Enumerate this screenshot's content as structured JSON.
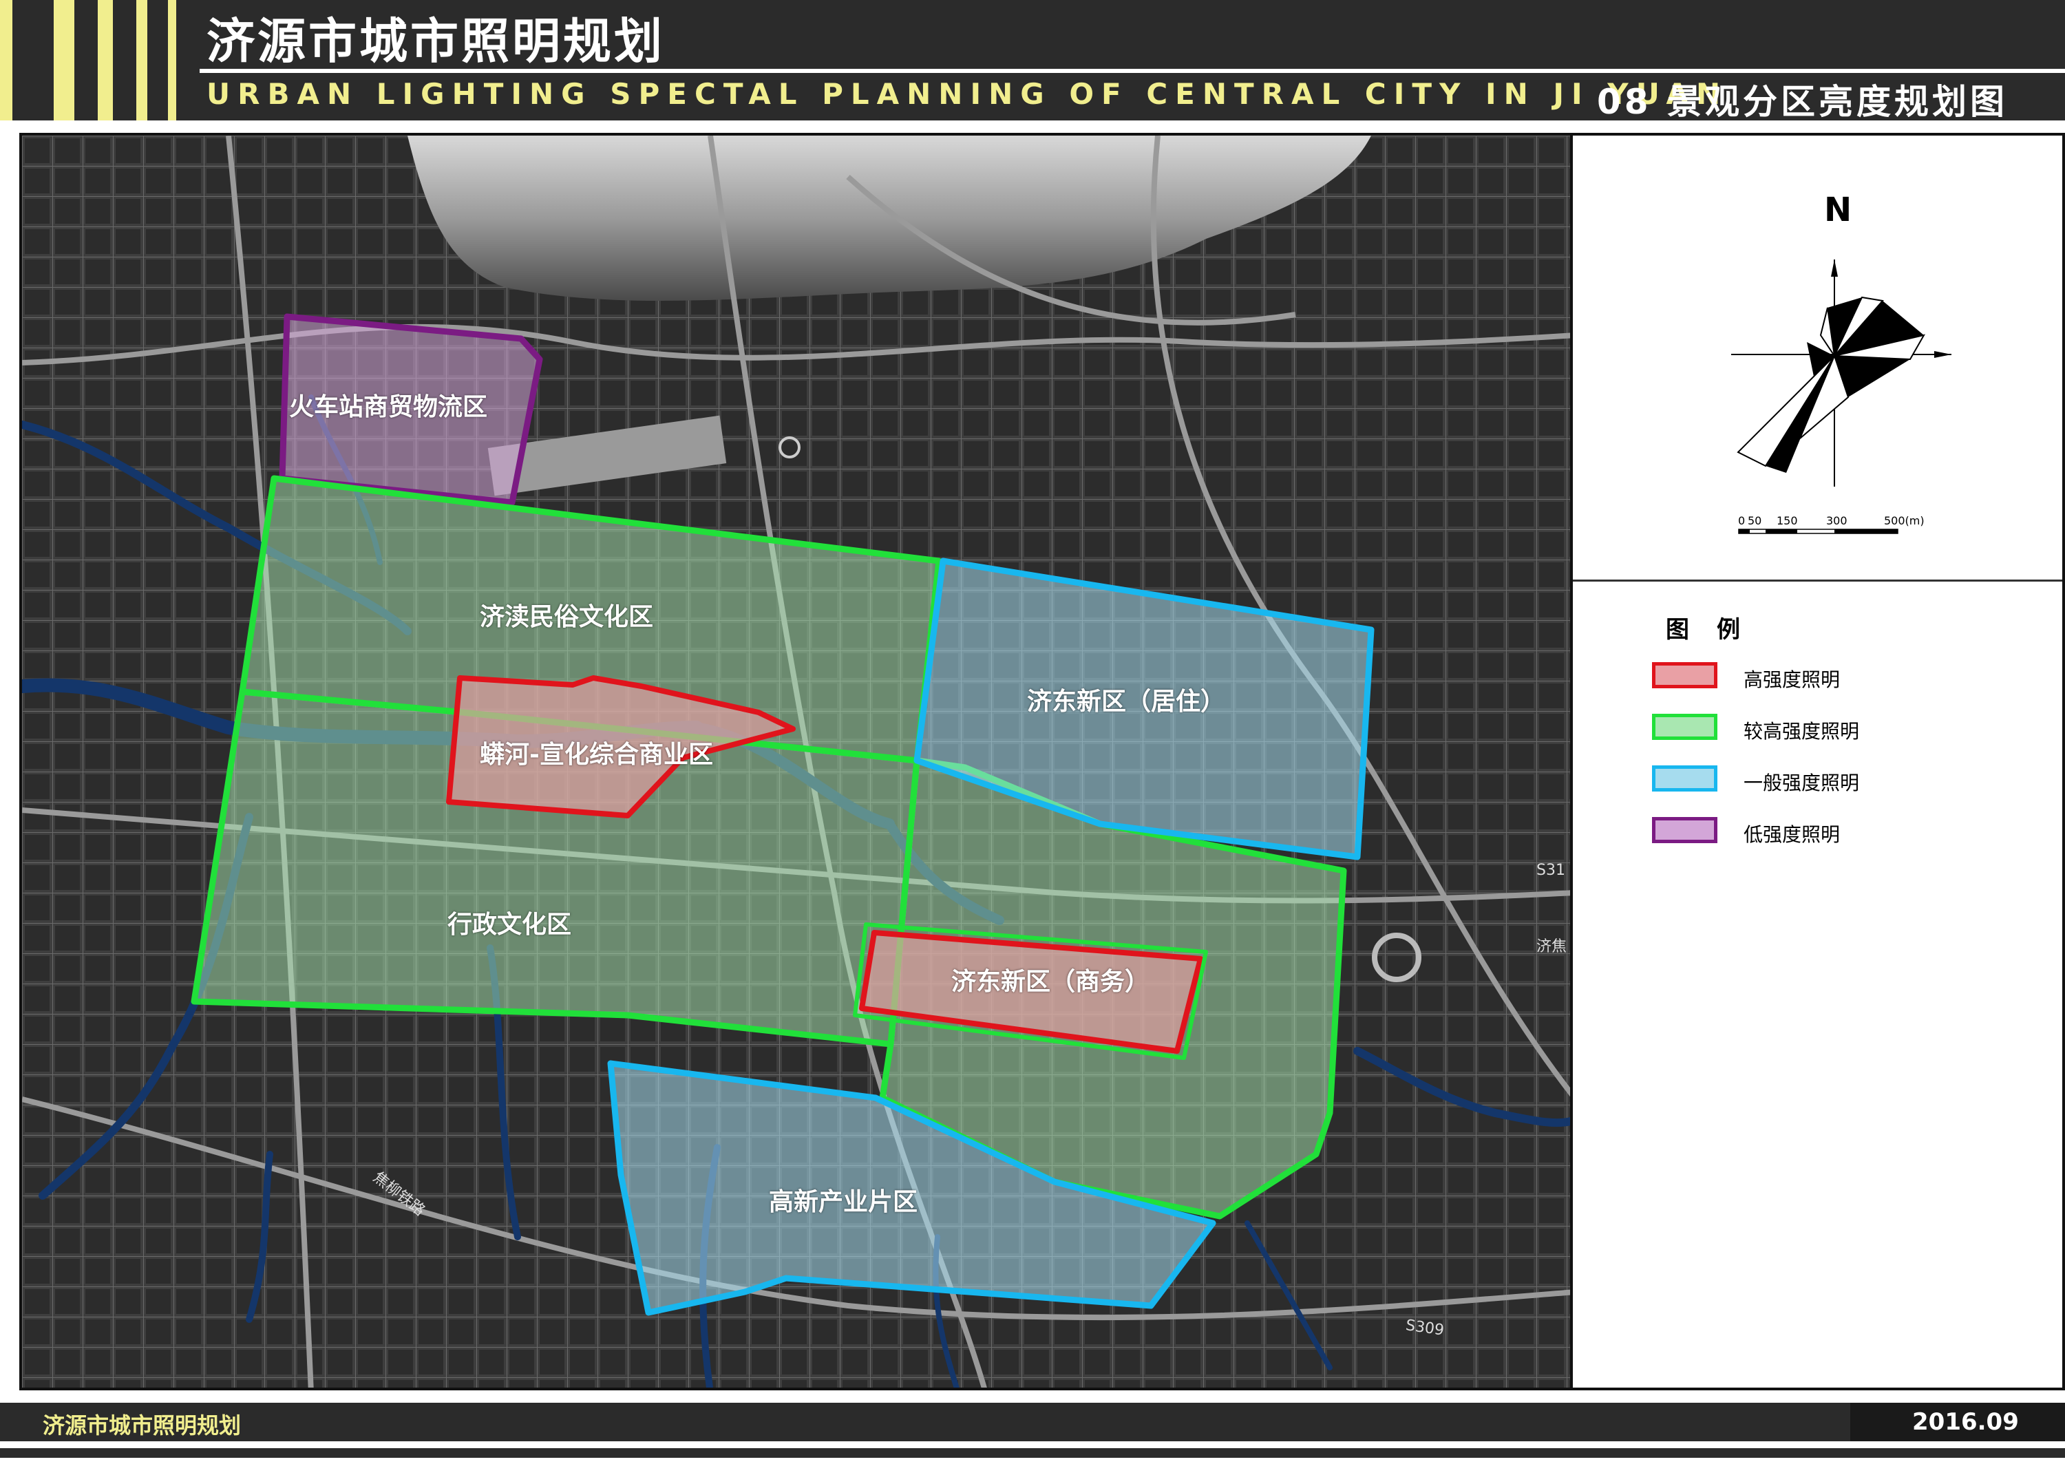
{
  "header": {
    "title": "济源市城市照明规划",
    "subtitle_en": "URBAN LIGHTING SPECTAL PLANNING OF CENTRAL CITY IN JI YUAN",
    "sheet_title": "08 景观分区亮度规划图",
    "accent_color": "#f1ee8e"
  },
  "map": {
    "zones": [
      {
        "id": "railway",
        "label": "火车站商贸物流区",
        "category": "低强度照明"
      },
      {
        "id": "jidu",
        "label": "济渎民俗文化区",
        "category": "较高强度照明"
      },
      {
        "id": "manghe",
        "label": "蟒河-宣化综合商业区",
        "category": "高强度照明"
      },
      {
        "id": "xingzheng",
        "label": "行政文化区",
        "category": "较高强度照明"
      },
      {
        "id": "jidong_res",
        "label": "济东新区（居住）",
        "category": "一般强度照明"
      },
      {
        "id": "jidong_com",
        "label": "济东新区（商务）",
        "category": "高强度照明"
      },
      {
        "id": "jidong_green",
        "label": "",
        "category": "较高强度照明"
      },
      {
        "id": "gaoxin",
        "label": "高新产业片区",
        "category": "一般强度照明"
      }
    ],
    "road_labels": {
      "railway": "焦柳铁路",
      "s309": "S309",
      "s31x": "S31",
      "jijiao": "济焦"
    }
  },
  "compass": {
    "north_label": "N"
  },
  "scale_bar": {
    "ticks": [
      "0",
      "50",
      "150",
      "300",
      "500(m)"
    ]
  },
  "legend": {
    "title": "图例",
    "items": [
      {
        "label": "高强度照明",
        "fill": "#e9a0a5",
        "stroke": "#e0141c"
      },
      {
        "label": "较高强度照明",
        "fill": "#a9e7b1",
        "stroke": "#21e03a"
      },
      {
        "label": "一般强度照明",
        "fill": "#a6dcee",
        "stroke": "#18b7ef"
      },
      {
        "label": "低强度照明",
        "fill": "#d3a6d8",
        "stroke": "#7b1b83"
      }
    ]
  },
  "footer": {
    "title": "济源市城市照明规划",
    "date": "2016.09"
  }
}
